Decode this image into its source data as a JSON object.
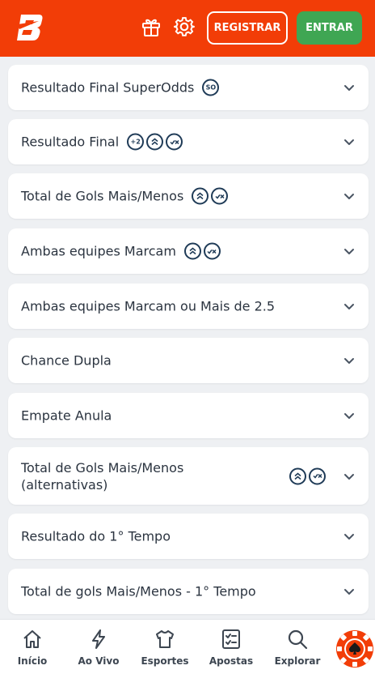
{
  "header": {
    "logo_icon": "brand-b-logo-icon",
    "gift_icon": "gift-icon",
    "settings_icon": "gear-icon",
    "register_label": "REGISTRAR",
    "login_label": "ENTRAR",
    "brand_color": "#f23d07",
    "login_color": "#3fa653"
  },
  "markets": [
    {
      "title": "Resultado Final SuperOdds",
      "badges": [
        "SO"
      ]
    },
    {
      "title": "Resultado Final",
      "badges": [
        "+2",
        "boost",
        "cashout"
      ]
    },
    {
      "title": "Total de Gols Mais/Menos",
      "badges": [
        "boost",
        "cashout"
      ]
    },
    {
      "title": "Ambas equipes Marcam",
      "badges": [
        "boost",
        "cashout"
      ]
    },
    {
      "title": "Ambas equipes Marcam ou Mais de 2.5",
      "badges": []
    },
    {
      "title": "Chance Dupla",
      "badges": []
    },
    {
      "title": "Empate Anula",
      "badges": []
    },
    {
      "title": "Total de Gols Mais/Menos (alternativas)",
      "badges": [
        "boost",
        "cashout"
      ]
    },
    {
      "title": "Resultado do 1° Tempo",
      "badges": []
    },
    {
      "title": "Total de gols Mais/Menos - 1° Tempo",
      "badges": []
    }
  ],
  "nav": {
    "items": [
      {
        "label": "Início",
        "icon": "home-icon"
      },
      {
        "label": "Ao Vivo",
        "icon": "lightning-icon"
      },
      {
        "label": "Esportes",
        "icon": "jersey-icon"
      },
      {
        "label": "Apostas",
        "icon": "betslip-icon"
      },
      {
        "label": "Explorar",
        "icon": "search-icon"
      }
    ],
    "casino_icon": "poker-chip-icon"
  }
}
